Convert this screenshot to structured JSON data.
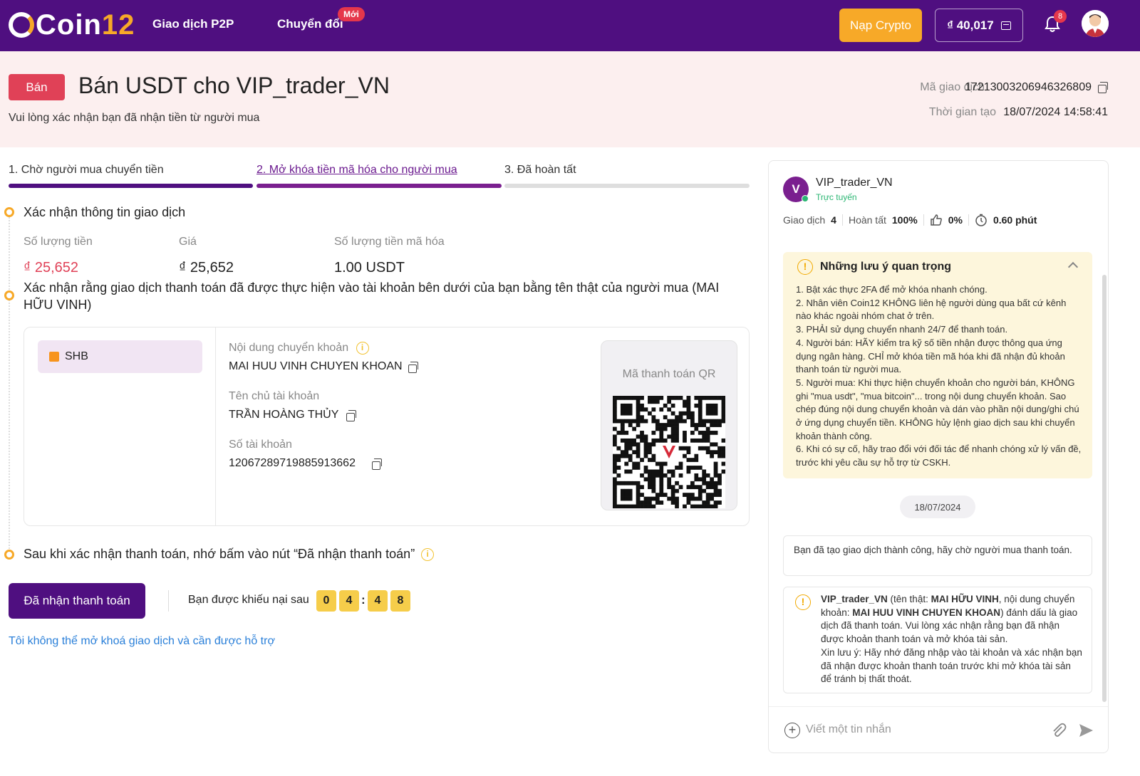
{
  "nav": {
    "brand_main": "Coin",
    "brand_num": "12",
    "p2p": "Giao dịch P2P",
    "convert": "Chuyển đổi",
    "new_badge": "Mới",
    "deposit": "Nạp Crypto",
    "balance": "₫ 40,017",
    "notif_count": "8"
  },
  "header": {
    "tag": "Bán",
    "title": "Bán USDT cho VIP_trader_VN",
    "subtitle": "Vui lòng xác nhận bạn đã nhận tiền từ người mua",
    "txid_label": "Mã giao dịch",
    "txid": "17213003206946326809",
    "created_label": "Thời gian tạo",
    "created": "18/07/2024 14:58:41"
  },
  "steps": {
    "s1": "1. Chờ người mua chuyển tiền",
    "s2": "2. Mở khóa tiền mã hóa cho người mua",
    "s3": "3. Đã hoàn tất"
  },
  "section1": {
    "title": "Xác nhận thông tin giao dịch",
    "amount_label": "Số lượng tiền",
    "amount": "₫ 25,652",
    "price_label": "Giá",
    "price": "₫ 25,652",
    "crypto_label": "Số lượng tiền mã hóa",
    "crypto": "1.00 USDT"
  },
  "section2": {
    "title": "Xác nhận rằng giao dịch thanh toán đã được thực hiện vào tài khoản bên dưới của bạn bằng tên thật của người mua (MAI HỮU VINH)",
    "bank": "SHB",
    "content_label": "Nội dung chuyển khoản",
    "content": "MAI HUU VINH CHUYEN KHOAN",
    "holder_label": "Tên chủ tài khoản",
    "holder": "TRẦN HOÀNG THỦY",
    "account_label": "Số tài khoản",
    "account": "12067289719885913662",
    "qr_title": "Mã thanh toán QR"
  },
  "section3": {
    "title": "Sau khi xác nhận thanh toán, nhớ bấm vào nút “Đã nhận thanh toán”"
  },
  "actions": {
    "received": "Đã nhận thanh toán",
    "complaint_label": "Bạn được khiếu nại sau",
    "d1": "0",
    "d2": "4",
    "d3": "4",
    "d4": "8",
    "help": "Tôi không thể mở khoá giao dịch và cần được hỗ trợ"
  },
  "chat": {
    "avatar_letter": "V",
    "name": "VIP_trader_VN",
    "status": "Trực tuyến",
    "trades_label": "Giao dịch",
    "trades": "4",
    "complete_label": "Hoàn tất",
    "complete": "100%",
    "rating": "0%",
    "time": "0.60 phút",
    "notes_title": "Những lưu ý quan trọng",
    "notes": [
      "1.  Bật xác thực 2FA để mở khóa nhanh chóng.",
      "2.  Nhân viên Coin12 KHÔNG liên hệ người dùng qua bất cứ kênh nào khác ngoài nhóm chat ở trên.",
      "3.  PHẢI sử dụng chuyển nhanh 24/7 để thanh toán.",
      "4.  Người bán: HÃY kiểm tra kỹ số tiền nhận được thông qua ứng dụng ngân hàng. CHỈ mở khóa tiền mã hóa khi đã nhận đủ khoản thanh toán từ người mua.",
      "5.  Người mua: Khi thực hiện chuyển khoản cho người bán, KHÔNG ghi \"mua usdt\", \"mua bitcoin\"... trong nội dung chuyển khoản. Sao chép đúng nội dung chuyển khoản và dán vào phần nội dung/ghi chú ở ứng dụng chuyển tiền. KHÔNG hủy lệnh giao dịch sau khi chuyển khoản thành công.",
      "6.  Khi có sự cố, hãy trao đổi với đối tác để nhanh chóng xử lý vấn đề, trước khi yêu cầu sự hỗ trợ từ CSKH."
    ],
    "date": "18/07/2024",
    "msg1": "Bạn đã tạo giao dịch thành công, hãy chờ người mua thanh toán.",
    "msg2_name": "VIP_trader_VN",
    "msg2_a": " (tên thật: ",
    "msg2_realname": "MAI HỮU VINH",
    "msg2_b": ", nội dung chuyển khoản: ",
    "msg2_content": "MAI HUU VINH CHUYEN KHOAN",
    "msg2_c": ") đánh dấu là giao dịch đã thanh toán. Vui lòng xác nhận rằng bạn đã nhận được khoản thanh toán và mở khóa tài sản.",
    "msg2_d": "Xin lưu ý: Hãy nhớ đăng nhập vào tài khoản và xác nhận bạn đã nhận được khoản thanh toán trước khi mở khóa tài sản để tránh bị thất thoát.",
    "input_placeholder": "Viết một tin nhắn"
  },
  "colors": {
    "brand_purple": "#4f0f80",
    "accent_orange": "#f7a928",
    "sell_red": "#e04157",
    "header_bg": "#fcefef"
  }
}
